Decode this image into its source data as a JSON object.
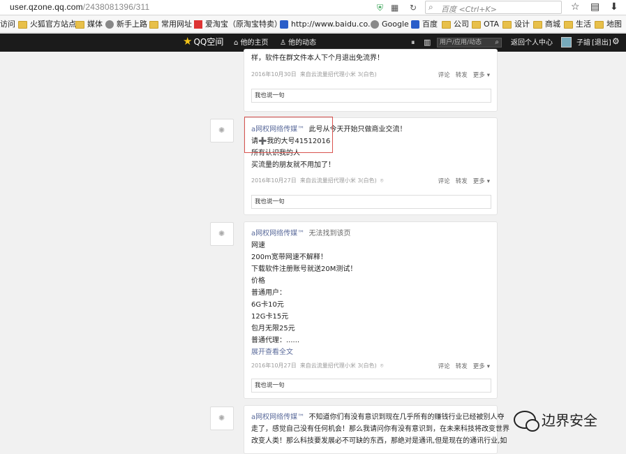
{
  "browser": {
    "url_host": "user.qzone.qq.com",
    "url_path": "/2438081396/311",
    "search_placeholder": "百度 <Ctrl+K>"
  },
  "bookmarks": [
    {
      "label": "访问",
      "icon": "none"
    },
    {
      "label": "火狐官方站点",
      "icon": "folder"
    },
    {
      "label": "媒体",
      "icon": "folder"
    },
    {
      "label": "新手上路",
      "icon": "globe"
    },
    {
      "label": "常用网址",
      "icon": "folder"
    },
    {
      "label": "爱淘宝（原淘宝特卖）",
      "icon": "taobao"
    },
    {
      "label": "http://www.baidu.co...",
      "icon": "baidu"
    },
    {
      "label": "Google",
      "icon": "globe"
    },
    {
      "label": "百度",
      "icon": "baidu"
    },
    {
      "label": "公司",
      "icon": "folder"
    },
    {
      "label": "OTA",
      "icon": "folder"
    },
    {
      "label": "设计",
      "icon": "folder"
    },
    {
      "label": "商城",
      "icon": "folder"
    },
    {
      "label": "生活",
      "icon": "folder"
    },
    {
      "label": "地图",
      "icon": "folder"
    }
  ],
  "qzone_nav": {
    "logo": "QQ空间",
    "home": "他的主页",
    "feeds": "他的动态",
    "search_placeholder": "用户/应用/动态",
    "back": "返回个人中心",
    "user": "子諳",
    "logout": "[退出]"
  },
  "posts": [
    {
      "text_lines": [
        "样，软件在群文件本人下个月退出免流界！"
      ],
      "date": "2016年10月30日",
      "source": "来自云流量招代理小米 3(白色)",
      "actions": [
        "评论",
        "转发",
        "更多"
      ],
      "reply": "我也说一句"
    },
    {
      "author": "a网权网络传媒™",
      "text_lines": [
        "此号从今天开始只做商业交流！",
        "请➕我的大号41512016",
        "所有认识我的人",
        "买流量的朋友就不用加了！"
      ],
      "date": "2016年10月27日",
      "source": "来自云流量招代理小米 3(白色)",
      "actions": [
        "评论",
        "转发",
        "更多"
      ],
      "reply": "我也说一句"
    },
    {
      "author": "a网权网络传媒™",
      "title": "无法找到该页",
      "text_lines": [
        "网速",
        "200m宽带网速不解释！",
        "下载软件注册账号就送20M测试！",
        "价格",
        "普通用户：",
        "6G卡10元",
        "12G卡15元",
        "包月无限25元",
        "普通代理：......"
      ],
      "expand": "展开查看全文",
      "date": "2016年10月27日",
      "source": "来自云流量招代理小米 3(白色)",
      "actions": [
        "评论",
        "转发",
        "更多"
      ],
      "reply": "我也说一句"
    },
    {
      "author": "a网权网络传媒™",
      "text_lines": [
        "不知道你们有没有意识到现在几乎所有的赚钱行业已经被别人夺",
        "走了，感觉自己没有任何机会！那么我请问你有没有意识到，在未来科技将改变世界",
        "改变人类！那么科技要发展必不可缺的东西，那绝对是通讯,但是现在的通讯行业,如"
      ]
    }
  ],
  "watermark": "边界安全"
}
